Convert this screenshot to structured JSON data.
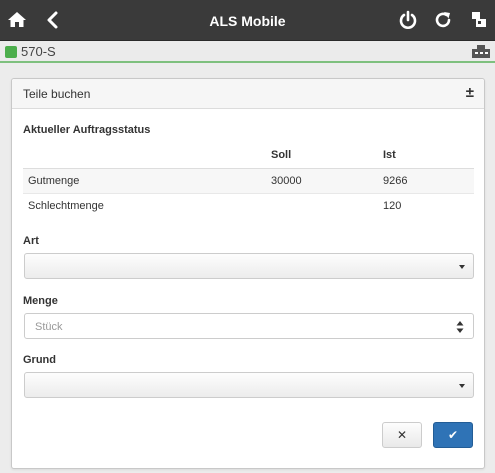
{
  "header": {
    "title": "ALS Mobile",
    "icons": [
      "home-icon",
      "back-icon",
      "power-icon",
      "refresh-icon",
      "station-icon"
    ]
  },
  "machine": {
    "id": "570-S",
    "status_color": "#4cae4c"
  },
  "panel": {
    "title": "Teile buchen",
    "toggle": "±",
    "status_heading": "Aktueller Auftragsstatus",
    "table": {
      "columns": [
        "",
        "Soll",
        "Ist"
      ],
      "rows": [
        [
          "Gutmenge",
          "30000",
          "9266"
        ],
        [
          "Schlechtmenge",
          "",
          "120"
        ]
      ]
    },
    "art": {
      "label": "Art",
      "value": ""
    },
    "menge": {
      "label": "Menge",
      "placeholder": "Stück",
      "value": ""
    },
    "grund": {
      "label": "Grund",
      "value": ""
    },
    "buttons": {
      "cancel": "✕",
      "confirm": "✔"
    }
  },
  "colors": {
    "topbar": "#3a3a3a",
    "accent": "#2f73b6",
    "status_ok": "#4cae4c"
  }
}
